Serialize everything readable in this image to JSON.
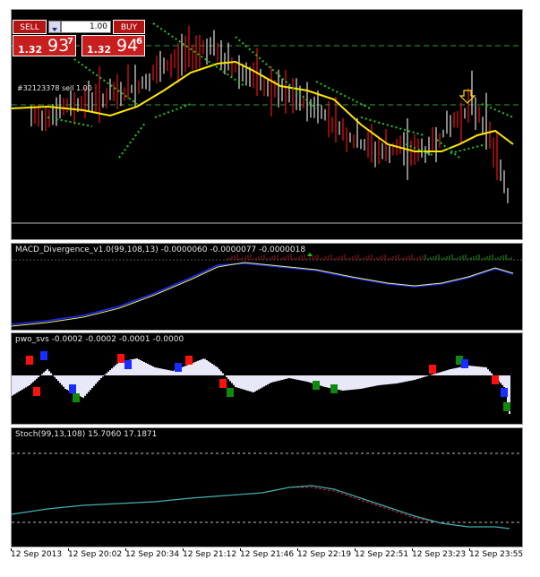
{
  "trade_panel": {
    "sell_label": "SELL",
    "buy_label": "BUY",
    "lot_value": "1.00",
    "sell_price_prefix": "1.32",
    "sell_price_big": "93",
    "sell_price_sup": "7",
    "buy_price_prefix": "1.32",
    "buy_price_big": "94",
    "buy_price_sup": "6"
  },
  "main_chart": {
    "order_label": "#32123378 sell 1.00"
  },
  "indicators": {
    "macd_label": "MACD_Divergence_v1.0(99,108,13) -0.0000060 -0.0000077 -0.0000018",
    "pwo_label": "pwo_svs -0.0002 -0.0002 -0.0001 -0.0000",
    "stoch_label": "Stoch(99,13,108) 15.7060 17.1871"
  },
  "time_axis": {
    "labels": [
      "12 Sep 2013",
      "12 Sep 20:02",
      "12 Sep 20:34",
      "12 Sep 21:12",
      "12 Sep 21:46",
      "12 Sep 22:19",
      "12 Sep 22:51",
      "12 Sep 23:23",
      "12 Sep 23:55"
    ]
  },
  "colors": {
    "background": "#000000",
    "candle": "#c0c0c0",
    "candle_down": "#d01010",
    "ma": "#ffe600",
    "bands": "#1ec81e",
    "macd_main": "#1a2cff",
    "macd_signal": "#f0f070",
    "pwo_fill": "#e8e8f8",
    "pwo_red": "#ff1010",
    "pwo_blue": "#1a2cff",
    "pwo_green": "#0f8a0f",
    "stoch_main": "#3fb0b0",
    "stoch_signal": "#d03030"
  }
}
